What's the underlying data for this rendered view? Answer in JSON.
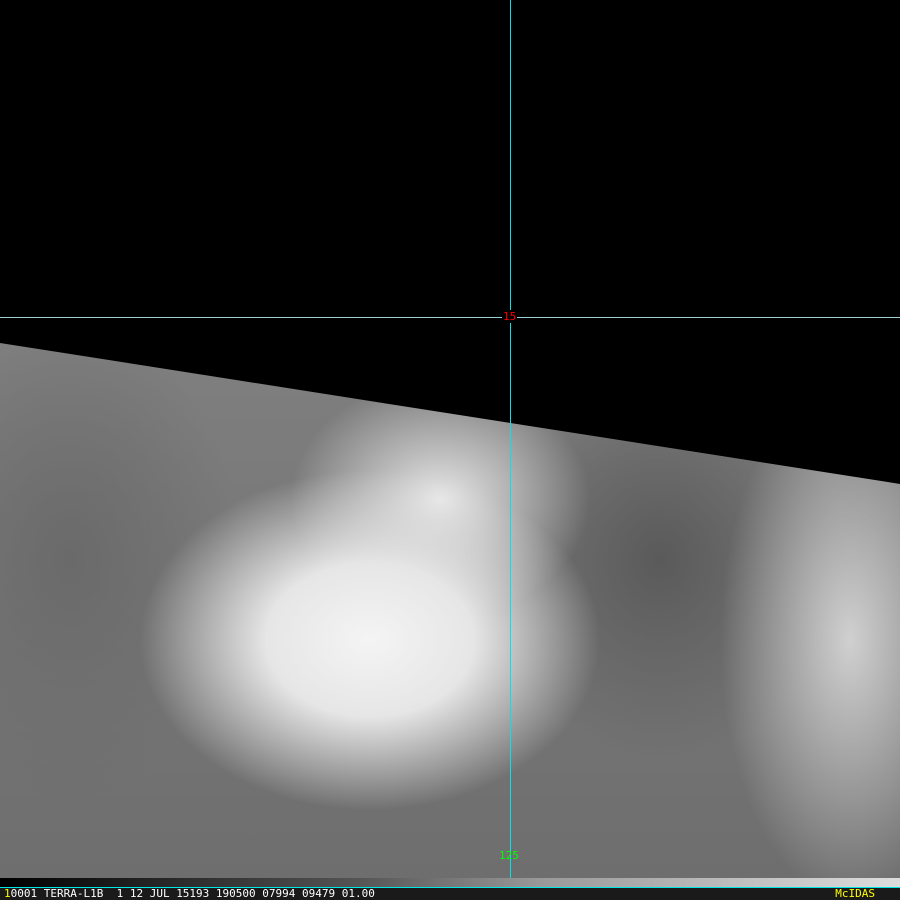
{
  "overlay": {
    "lat_label": "15",
    "lon_label": "125",
    "line_color": "#00e5e5"
  },
  "status_bar": {
    "frame": "1",
    "text": "0001 TERRA-L1B  1 12 JUL 15193 190500 07994 09479 01.00",
    "brand": "McIDAS"
  }
}
